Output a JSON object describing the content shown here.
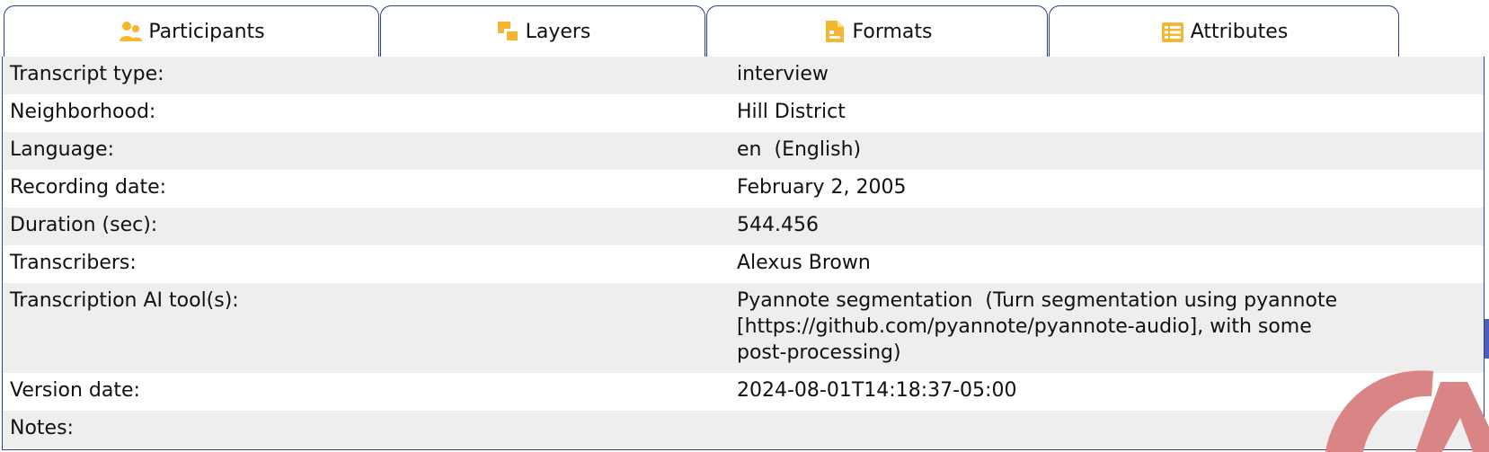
{
  "tabs": [
    {
      "label": "Participants",
      "icon": "participants-icon"
    },
    {
      "label": "Layers",
      "icon": "layers-icon"
    },
    {
      "label": "Formats",
      "icon": "formats-icon"
    },
    {
      "label": "Attributes",
      "icon": "attributes-icon"
    }
  ],
  "active_tab": "Attributes",
  "accent_color": "#f5b731",
  "border_color": "#2a3f9d",
  "attributes": [
    {
      "label": "Transcript type:",
      "value": "interview"
    },
    {
      "label": "Neighborhood:",
      "value": "Hill District"
    },
    {
      "label": "Language:",
      "value": "en",
      "note": "(English)"
    },
    {
      "label": "Recording date:",
      "value": "February 2, 2005"
    },
    {
      "label": "Duration (sec):",
      "value": "544.456"
    },
    {
      "label": "Transcribers:",
      "value": "Alexus Brown"
    },
    {
      "label": "Transcription AI tool(s):",
      "value": "Pyannote segmentation",
      "note": "(Turn segmentation using pyannote [https://github.com/pyannote/pyannote-audio], with some post-processing)"
    },
    {
      "label": "Version date:",
      "value": "2024-08-01T14:18:37-05:00"
    },
    {
      "label": "Notes:",
      "value": ""
    }
  ]
}
